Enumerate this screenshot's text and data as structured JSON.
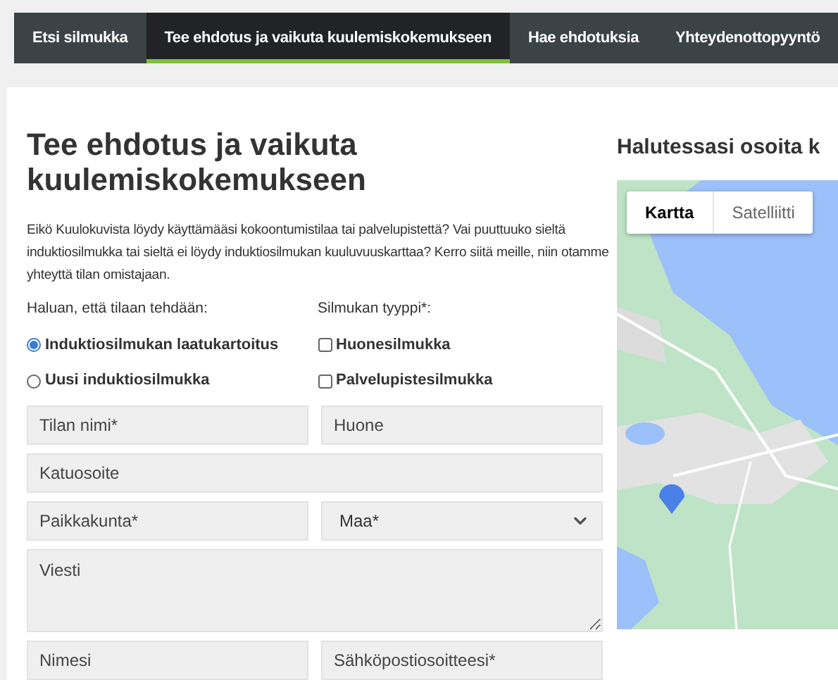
{
  "nav": {
    "tabs": [
      {
        "label": "Etsi silmukka",
        "selected": false
      },
      {
        "label": "Tee ehdotus ja vaikuta kuulemiskokemukseen",
        "selected": true
      },
      {
        "label": "Hae ehdotuksia",
        "selected": false
      },
      {
        "label": "Yhteydenottopyyntö",
        "selected": false
      }
    ]
  },
  "form": {
    "title": "Tee ehdotus ja vaikuta kuulemiskokemukseen",
    "intro": "Eikö Kuulokuvista löydy käyttämääsi kokoontumistilaa tai palvelupistettä? Vai puuttuuko sieltä induktiosilmukka tai sieltä ei löydy induktiosilmukan kuuluvuuskarttaa?  Kerro siitä meille, niin otamme yhteyttä tilan omistajaan.",
    "request": {
      "label": "Haluan, että tilaan tehdään:",
      "options": [
        {
          "label": "Induktiosilmukan laatukartoitus",
          "selected": true
        },
        {
          "label": "Uusi induktiosilmukka",
          "selected": false
        }
      ]
    },
    "loop_type": {
      "label": "Silmukan tyyppi*:",
      "options": [
        {
          "label": "Huonesilmukka",
          "checked": false
        },
        {
          "label": "Palvelupistesilmukka",
          "checked": false
        }
      ]
    },
    "rows": [
      [
        {
          "kind": "input",
          "placeholder": "Tilan nimi*"
        },
        {
          "kind": "input",
          "placeholder": "Huone"
        }
      ],
      [
        {
          "kind": "input",
          "placeholder": "Katuosoite"
        }
      ],
      [
        {
          "kind": "input",
          "placeholder": "Paikkakunta*"
        },
        {
          "kind": "select",
          "value": "Maa*"
        }
      ],
      [
        {
          "kind": "textarea",
          "placeholder": "Viesti"
        }
      ],
      [
        {
          "kind": "input",
          "placeholder": "Nimesi"
        },
        {
          "kind": "input",
          "placeholder": "Sähköpostiosoitteesi*"
        }
      ]
    ]
  },
  "map_section": {
    "title": "Halutessasi osoita k",
    "map": {
      "kind": "picture",
      "modes": [
        {
          "label": "Kartta",
          "selected": true
        },
        {
          "label": "Satelliitti",
          "selected": false
        }
      ]
    }
  }
}
